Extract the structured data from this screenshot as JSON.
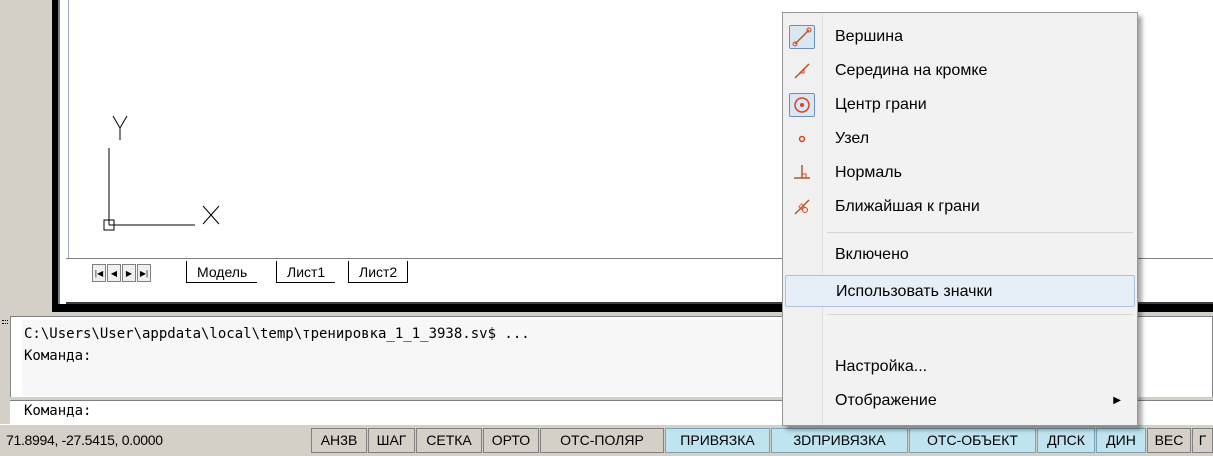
{
  "tabs": {
    "model": "Модель",
    "sheet1": "Лист1",
    "sheet2": "Лист2"
  },
  "ucs": {
    "x_label": "X",
    "y_label": "Y"
  },
  "command": {
    "history_line1": "C:\\Users\\User\\appdata\\local\\temp\\тренировка_1_1_3938.sv$ ...",
    "history_line2": "Команда:",
    "input_prompt": "Команда:"
  },
  "status": {
    "coords": "71.8994, -27.5415, 0.0000",
    "buttons": [
      {
        "label": "АН3В",
        "on": false
      },
      {
        "label": "ШАГ",
        "on": false
      },
      {
        "label": "СЕТКА",
        "on": false
      },
      {
        "label": "ОРТО",
        "on": false
      },
      {
        "label": "ОТС-ПОЛЯР",
        "on": false
      },
      {
        "label": "ПРИВЯЗКА",
        "on": true
      },
      {
        "label": "3DПРИВЯЗКА",
        "on": true
      },
      {
        "label": "ОТС-ОБЪЕКТ",
        "on": true
      },
      {
        "label": "ДПСК",
        "on": true
      },
      {
        "label": "ДИН",
        "on": true
      },
      {
        "label": "ВЕС",
        "on": false
      },
      {
        "label": "Г",
        "on": false
      }
    ]
  },
  "menu": {
    "items": [
      {
        "label": "Вершина",
        "icon": "vertex-snap-icon"
      },
      {
        "label": "Середина на кромке",
        "icon": "midpoint-edge-icon"
      },
      {
        "label": "Центр грани",
        "icon": "face-center-icon"
      },
      {
        "label": "Узел",
        "icon": "node-icon"
      },
      {
        "label": "Нормаль",
        "icon": "perpendicular-icon"
      },
      {
        "label": "Ближайшая к грани",
        "icon": "nearest-face-icon"
      }
    ],
    "enabled": "Включено",
    "use_icons": "Использовать значки",
    "settings": "Настройка...",
    "display": "Отображение"
  }
}
